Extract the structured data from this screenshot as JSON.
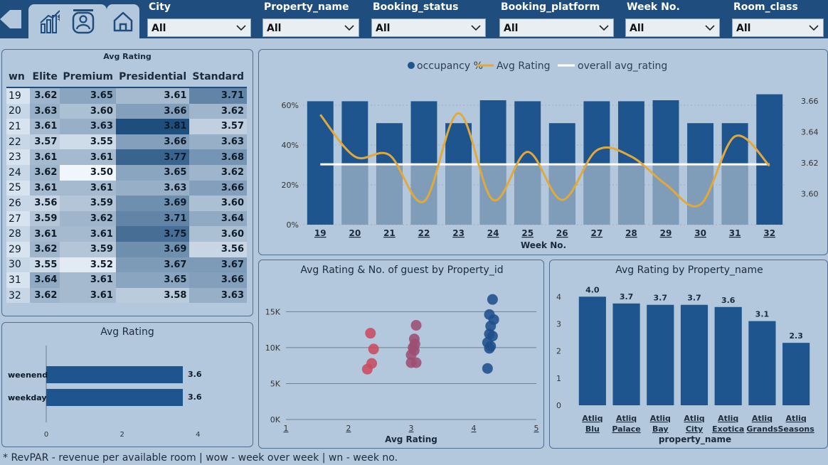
{
  "nav": {
    "icons": [
      "revenue-chart-icon",
      "guest-icon",
      "home-icon"
    ]
  },
  "filters": [
    {
      "label": "City",
      "value": "All"
    },
    {
      "label": "Property_name",
      "value": "All"
    },
    {
      "label": "Booking_status",
      "value": "All"
    },
    {
      "label": "Booking_platform",
      "value": "All"
    },
    {
      "label": "Week No.",
      "value": "All"
    },
    {
      "label": "Room_class",
      "value": "All"
    }
  ],
  "matrix": {
    "title": "Avg Rating",
    "headers": [
      "wn",
      "Elite",
      "Premium",
      "Presidential",
      "Standard"
    ],
    "rows": [
      [
        "19",
        "3.62",
        "3.65",
        "3.61",
        "3.71"
      ],
      [
        "20",
        "3.63",
        "3.60",
        "3.66",
        "3.62"
      ],
      [
        "21",
        "3.61",
        "3.63",
        "3.81",
        "3.57"
      ],
      [
        "22",
        "3.57",
        "3.55",
        "3.66",
        "3.63"
      ],
      [
        "23",
        "3.61",
        "3.61",
        "3.77",
        "3.68"
      ],
      [
        "24",
        "3.62",
        "3.50",
        "3.65",
        "3.62"
      ],
      [
        "25",
        "3.61",
        "3.61",
        "3.63",
        "3.66"
      ],
      [
        "26",
        "3.56",
        "3.59",
        "3.69",
        "3.60"
      ],
      [
        "27",
        "3.59",
        "3.62",
        "3.71",
        "3.64"
      ],
      [
        "28",
        "3.61",
        "3.61",
        "3.75",
        "3.60"
      ],
      [
        "29",
        "3.62",
        "3.59",
        "3.69",
        "3.56"
      ],
      [
        "30",
        "3.55",
        "3.52",
        "3.67",
        "3.67"
      ],
      [
        "31",
        "3.64",
        "3.61",
        "3.65",
        "3.66"
      ],
      [
        "32",
        "3.62",
        "3.61",
        "3.58",
        "3.63"
      ]
    ]
  },
  "colors": {
    "header_bg": "#1f4e7e",
    "page_bg": "#b4c8dd",
    "bar_dark": "#1f558f",
    "bar_light": "#7f9db9",
    "line_gold": "#e2a93a",
    "scatter_red": "#c94a5e",
    "scatter_mauve": "#9c4f73",
    "scatter_blue": "#1f4e8c"
  },
  "footer": "*  RevPAR - revenue per available room  |   wow - week over week  |  wn - week no.",
  "chart_data": [
    {
      "type": "bar",
      "title": "Avg Rating",
      "orientation": "horizontal",
      "categories": [
        "weenend",
        "weekday"
      ],
      "values": [
        3.6,
        3.6
      ],
      "data_labels": [
        "3.6",
        "3.6"
      ],
      "xlim": [
        0,
        4.5
      ],
      "xticks": [
        "0",
        "2",
        "4"
      ]
    },
    {
      "type": "bar+line",
      "title": "",
      "legend": [
        "occupancy %",
        "Avg Rating",
        "overall avg_rating"
      ],
      "legend_position": "top-center",
      "xlabel": "Week No.",
      "categories": [
        "19",
        "20",
        "21",
        "22",
        "23",
        "24",
        "25",
        "26",
        "27",
        "28",
        "29",
        "30",
        "31",
        "32"
      ],
      "series": [
        {
          "name": "occupancy %",
          "axis": "left",
          "values": [
            62,
            62,
            51,
            62,
            51,
            62.5,
            62,
            51,
            62,
            62,
            62.5,
            51,
            51,
            65.5
          ]
        },
        {
          "name": "Avg Rating",
          "axis": "right",
          "values": [
            3.651,
            3.624,
            3.625,
            3.595,
            3.652,
            3.596,
            3.627,
            3.596,
            3.628,
            3.624,
            3.606,
            3.593,
            3.637,
            3.618
          ]
        },
        {
          "name": "overall avg_rating",
          "axis": "right",
          "values": [
            3.619,
            3.619,
            3.619,
            3.619,
            3.619,
            3.619,
            3.619,
            3.619,
            3.619,
            3.619,
            3.619,
            3.619,
            3.619,
            3.619
          ]
        }
      ],
      "yticks_left": [
        "0%",
        "20%",
        "40%",
        "60%"
      ],
      "ylim_left": [
        0,
        70
      ],
      "yticks_right": [
        "3.60",
        "3.62",
        "3.64",
        "3.66"
      ],
      "ylim_right": [
        3.58,
        3.67
      ]
    },
    {
      "type": "scatter",
      "title": "Avg Rating & No. of guest by Property_id",
      "xlabel": "Avg Rating",
      "xlim": [
        1,
        5
      ],
      "ylim": [
        0,
        18000
      ],
      "xticks": [
        "1",
        "2",
        "3",
        "4",
        "5"
      ],
      "yticks": [
        "0K",
        "5K",
        "10K",
        "15K"
      ],
      "points": [
        {
          "x": 2.35,
          "y": 12000,
          "g": "red"
        },
        {
          "x": 2.4,
          "y": 9800,
          "g": "red"
        },
        {
          "x": 2.37,
          "y": 7800,
          "g": "red"
        },
        {
          "x": 2.3,
          "y": 7000,
          "g": "red"
        },
        {
          "x": 3.08,
          "y": 13100,
          "g": "mauve"
        },
        {
          "x": 3.05,
          "y": 11200,
          "g": "mauve"
        },
        {
          "x": 3.06,
          "y": 10500,
          "g": "mauve"
        },
        {
          "x": 3.03,
          "y": 10000,
          "g": "mauve"
        },
        {
          "x": 3.05,
          "y": 9600,
          "g": "mauve"
        },
        {
          "x": 3.0,
          "y": 9000,
          "g": "mauve"
        },
        {
          "x": 3.0,
          "y": 7900,
          "g": "mauve"
        },
        {
          "x": 3.08,
          "y": 7900,
          "g": "mauve"
        },
        {
          "x": 4.3,
          "y": 16700,
          "g": "blue"
        },
        {
          "x": 4.25,
          "y": 14600,
          "g": "blue"
        },
        {
          "x": 4.32,
          "y": 13900,
          "g": "blue"
        },
        {
          "x": 4.27,
          "y": 13000,
          "g": "blue"
        },
        {
          "x": 4.25,
          "y": 11900,
          "g": "blue"
        },
        {
          "x": 4.3,
          "y": 11600,
          "g": "blue"
        },
        {
          "x": 4.22,
          "y": 10700,
          "g": "blue"
        },
        {
          "x": 4.27,
          "y": 10200,
          "g": "blue"
        },
        {
          "x": 4.25,
          "y": 9900,
          "g": "blue"
        },
        {
          "x": 4.22,
          "y": 7100,
          "g": "blue"
        }
      ]
    },
    {
      "type": "bar",
      "title": "Avg Rating by Property_name",
      "xlabel": "property_name",
      "categories": [
        "Atliq Blu",
        "Atliq Palace",
        "Atliq Bay",
        "Atliq City",
        "Atliq Exotica",
        "Atliq Grands",
        "Atliq Seasons"
      ],
      "category_lines": [
        [
          "Atliq",
          "Blu"
        ],
        [
          "Atliq",
          "Palace"
        ],
        [
          "Atliq",
          "Bay"
        ],
        [
          "Atliq",
          "City"
        ],
        [
          "Atliq",
          "Exotica"
        ],
        [
          "Atliq",
          "Grands"
        ],
        [
          "Atliq",
          "Seasons"
        ]
      ],
      "values": [
        4.0,
        3.75,
        3.7,
        3.7,
        3.62,
        3.1,
        2.3
      ],
      "data_labels": [
        "4.0",
        "3.7",
        "3.7",
        "3.7",
        "3.6",
        "3.1",
        "2.3"
      ],
      "ylim": [
        0,
        4.4
      ],
      "yticks": [
        "0",
        "1",
        "2",
        "3",
        "4"
      ]
    }
  ]
}
